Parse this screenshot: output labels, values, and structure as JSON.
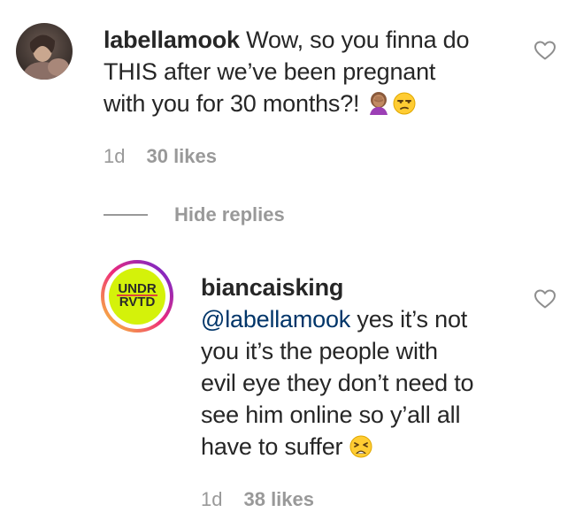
{
  "comment1": {
    "username": "labellamook",
    "text_line1": " Wow, so you finna do",
    "text_line2": "THIS after we’ve been pregnant",
    "text_line3": "with you for 30 months?! ",
    "emojis": [
      "woman-facepalming-icon",
      "unamused-face-icon"
    ],
    "age": "1d",
    "likes": "30 likes"
  },
  "replies_toggle": {
    "label": "Hide replies"
  },
  "comment2": {
    "username": "biancaisking",
    "mention": "@labellamook",
    "text_line1": " yes it’s not",
    "text_line2": "you it’s the people with",
    "text_line3": "evil eye they don’t need to",
    "text_line4": "see him online so y’all all",
    "text_line5": "have to suffer ",
    "emojis": [
      "weary-face-icon"
    ],
    "age": "1d",
    "likes": "38 likes",
    "avatar_text_top": "UNDR",
    "avatar_text_bottom": "RVTD"
  },
  "colors": {
    "text": "#262626",
    "muted": "#999999",
    "mention": "#003569",
    "story_ring_start": "#f9ce34",
    "story_ring_mid": "#ee2a7b",
    "story_ring_end": "#6228d7",
    "avatar2_fill": "#d4f20a"
  }
}
